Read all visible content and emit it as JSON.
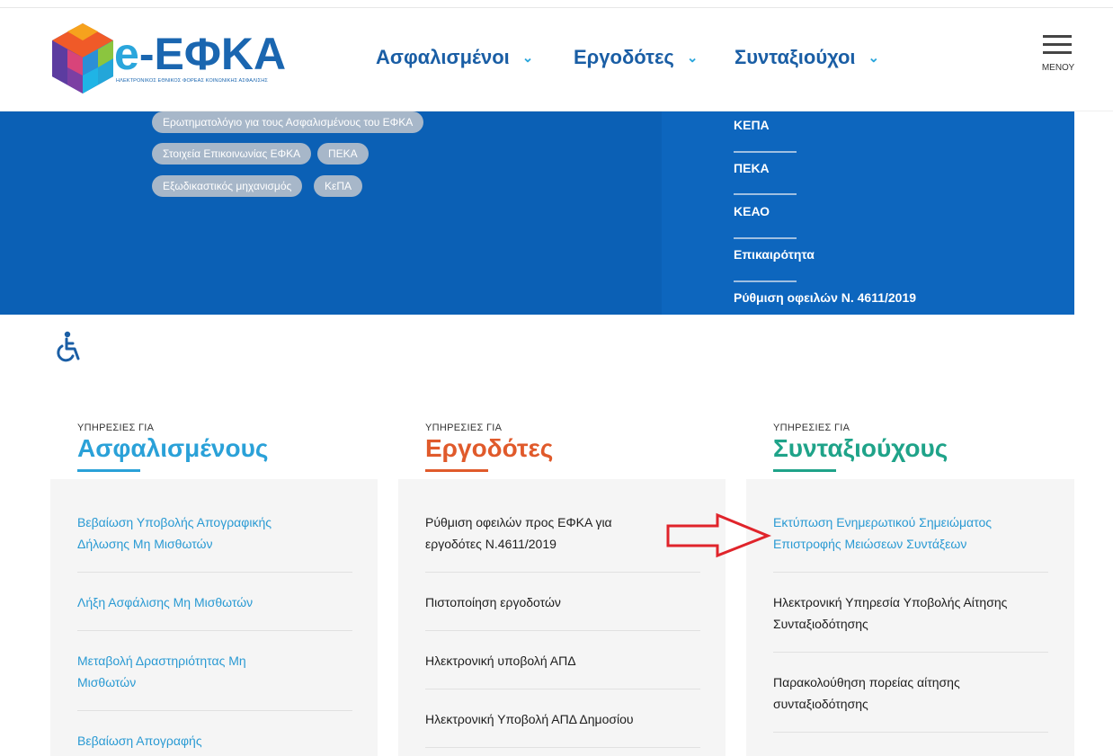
{
  "header": {
    "logo_text": "e-ΕΦΚΑ",
    "logo_prefix": "e",
    "logo_main": "-ΕΦΚΑ",
    "logo_subtitle": "ΗΛΕΚΤΡΟΝΙΚΟΣ ΕΘΝΙΚΟΣ ΦΟΡΕΑΣ ΚΟΙΝΩΝΙΚΗΣ ΑΣΦΑΛΙΣΗΣ",
    "nav": [
      {
        "label": "Ασφαλισμένοι",
        "icon": "chevron-down-icon"
      },
      {
        "label": "Εργοδότες",
        "icon": "chevron-down-icon"
      },
      {
        "label": "Συνταξιούχοι",
        "icon": "chevron-down-icon"
      }
    ],
    "menu_label": "ΜΕΝΟΥ"
  },
  "band": {
    "tags": [
      "Ερωτηματολόγιο για τους Ασφαλισμένους του ΕΦΚΑ",
      "Στοιχεία Επικοινωνίας ΕΦΚΑ",
      "ΠΕΚΑ",
      "Εξωδικαστικός μηχανισμός",
      "ΚεΠΑ"
    ],
    "right_links": [
      "ΚΕΠΑ",
      "ΠΕΚΑ",
      "ΚΕΑΟ",
      "Επικαιρότητα",
      "Ρύθμιση οφειλών Ν. 4611/2019"
    ]
  },
  "accessibility_icon": "wheelchair-icon",
  "columns": [
    {
      "kicker": "ΥΠΗΡΕΣΙΕΣ ΓΙΑ",
      "title": "Ασφαλισμένους",
      "color": "#2aa1d8",
      "items": [
        [
          "Βεβαίωση Υποβολής Απογραφικής",
          "Δήλωσης Μη Μισθωτών"
        ],
        [
          "Λήξη Ασφάλισης Μη Μισθωτών"
        ],
        [
          "Μεταβολή Δραστηριότητας Μη",
          "Μισθωτών"
        ],
        [
          "Βεβαίωση Απογραφής"
        ]
      ]
    },
    {
      "kicker": "ΥΠΗΡΕΣΙΕΣ ΓΙΑ",
      "title": "Εργοδότες",
      "color": "#e05a2b",
      "items": [
        [
          "Ρύθμιση οφειλών προς ΕΦΚΑ για",
          "εργοδότες Ν.4611/2019"
        ],
        [
          "Πιστοποίηση εργοδοτών"
        ],
        [
          "Ηλεκτρονική υποβολή ΑΠΔ"
        ],
        [
          "Ηλεκτρονική Υποβολή ΑΠΔ Δημοσίου"
        ]
      ]
    },
    {
      "kicker": "ΥΠΗΡΕΣΙΕΣ ΓΙΑ",
      "title": "Συνταξιούχους",
      "color": "#1fa389",
      "items": [
        [
          "Εκτύπωση Ενημερωτικού Σημειώματος",
          "Επιστροφής Μειώσεων Συντάξεων"
        ],
        [
          "Ηλεκτρονική Υπηρεσία Υποβολής Αίτησης",
          "Συνταξιοδότησης"
        ],
        [
          "Παρακολούθηση πορείας αίτησης",
          "συνταξιοδότησης"
        ]
      ]
    }
  ],
  "colors": {
    "brand_blue": "#1a5ea5",
    "band_blue": "#0b60b5",
    "arrow_red": "#e0242b"
  }
}
